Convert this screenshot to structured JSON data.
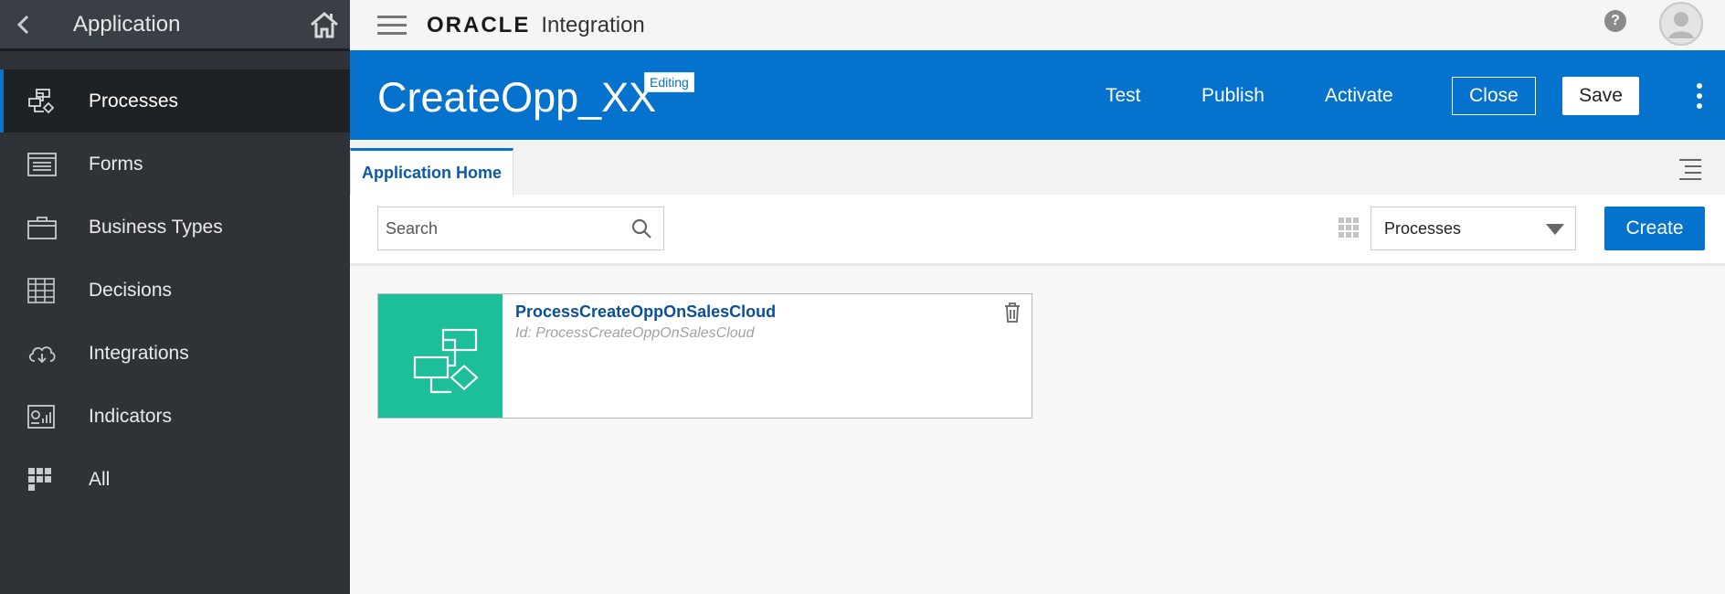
{
  "sidebar": {
    "title": "Application",
    "items": [
      {
        "label": "Processes",
        "icon": "process-icon"
      },
      {
        "label": "Forms",
        "icon": "form-icon"
      },
      {
        "label": "Business Types",
        "icon": "briefcase-icon"
      },
      {
        "label": "Decisions",
        "icon": "table-icon"
      },
      {
        "label": "Integrations",
        "icon": "cloud-icon"
      },
      {
        "label": "Indicators",
        "icon": "chart-icon"
      },
      {
        "label": "All",
        "icon": "grid-icon"
      }
    ],
    "active_index": 0
  },
  "topbar": {
    "brand": "ORACLE",
    "product": "Integration",
    "help_glyph": "?"
  },
  "header": {
    "title": "CreateOpp_XX",
    "badge": "Editing",
    "actions": {
      "test": "Test",
      "publish": "Publish",
      "activate": "Activate",
      "close": "Close",
      "save": "Save"
    }
  },
  "tabs": {
    "active": "Application Home"
  },
  "toolbar": {
    "search_placeholder": "Search",
    "filter_value": "Processes",
    "create_label": "Create"
  },
  "cards": [
    {
      "name": "ProcessCreateOppOnSalesCloud",
      "id_text": "Id: ProcessCreateOppOnSalesCloud"
    }
  ],
  "colors": {
    "accent": "#0572ce",
    "sidebar_bg": "#2f3338",
    "card_thumb": "#1dbf9a"
  }
}
